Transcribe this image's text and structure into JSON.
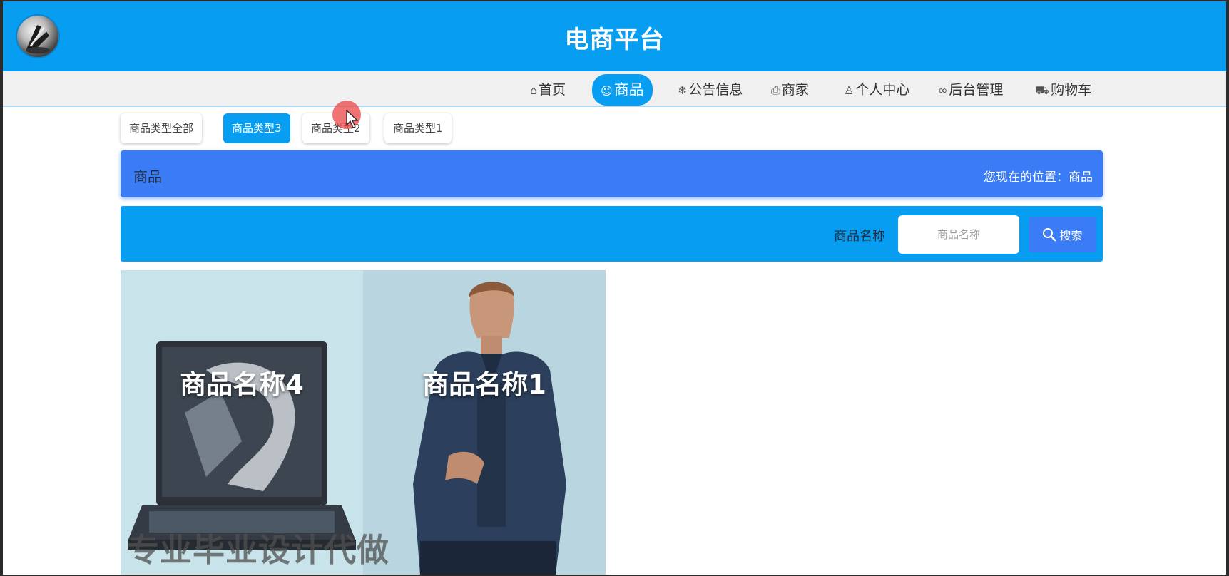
{
  "header": {
    "title": "电商平台",
    "logo_icon": "avatar-logo-icon",
    "background": "#079df1"
  },
  "nav": {
    "items": [
      {
        "label": "首页",
        "icon": "home-icon",
        "active": false
      },
      {
        "label": "商品",
        "icon": "smile-icon",
        "active": true
      },
      {
        "label": "公告信息",
        "icon": "snowflake-icon",
        "active": false
      },
      {
        "label": "商家",
        "icon": "printer-icon",
        "active": false
      },
      {
        "label": "个人中心",
        "icon": "user-icon",
        "active": false
      },
      {
        "label": "后台管理",
        "icon": "link-icon",
        "active": false
      },
      {
        "label": "购物车",
        "icon": "cart-icon",
        "active": false
      }
    ]
  },
  "categories": {
    "tabs": [
      {
        "label": "商品类型全部",
        "active": false
      },
      {
        "label": "商品类型3",
        "active": true
      },
      {
        "label": "商品类型2",
        "active": false
      },
      {
        "label": "商品类型1",
        "active": false
      }
    ]
  },
  "breadcrumb": {
    "title": "商品",
    "location": "您现在的位置：商品"
  },
  "search": {
    "label": "商品名称",
    "placeholder": "商品名称",
    "button_label": "搜索",
    "button_icon": "search-icon"
  },
  "products": [
    {
      "name": "商品名称4",
      "image": "laptop-image"
    },
    {
      "name": "商品名称1",
      "image": "jacket-model-image"
    }
  ],
  "watermark": "专业毕业设计代做",
  "colors": {
    "primary": "#079df1",
    "accent": "#3a7bf6",
    "nav_bg": "#f0f0f0"
  }
}
